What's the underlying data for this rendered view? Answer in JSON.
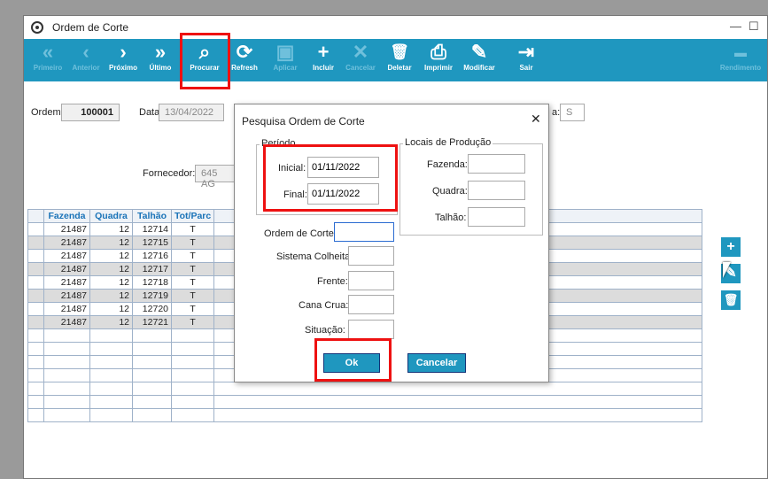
{
  "window": {
    "title": "Ordem de Corte",
    "minimize": "—",
    "maximize": "☐"
  },
  "toolbar": {
    "primeiro": {
      "icon": "«",
      "label": "Primeiro"
    },
    "anterior": {
      "icon": "‹",
      "label": "Anterior"
    },
    "proximo": {
      "icon": "›",
      "label": "Próximo"
    },
    "ultimo": {
      "icon": "»",
      "label": "Último"
    },
    "procurar": {
      "icon": "⌕",
      "label": "Procurar"
    },
    "refresh": {
      "icon": "⟳",
      "label": "Refresh"
    },
    "aplicar": {
      "icon": "▣",
      "label": "Aplicar"
    },
    "incluir": {
      "icon": "+",
      "label": "Incluir"
    },
    "cancelar": {
      "icon": "✕",
      "label": "Cancelar"
    },
    "deletar": {
      "icon": "🗑",
      "label": "Deletar"
    },
    "imprimir": {
      "icon": "⎙",
      "label": "Imprimir"
    },
    "modificar": {
      "icon": "✎",
      "label": "Modificar"
    },
    "sair": {
      "icon": "⇥",
      "label": "Sair"
    },
    "rendimento": {
      "label": "Rendimento"
    }
  },
  "form": {
    "ordem_label": "Ordem:",
    "ordem_value": "100001",
    "data_label": "Data:",
    "data_value": "13/04/2022",
    "s_label": "a:",
    "s_value": "S",
    "fornecedor_label": "Fornecedor:",
    "fornecedor_value": "645 AG"
  },
  "grid": {
    "headers": [
      "Fazenda",
      "Quadra",
      "Talhão",
      "Tot/Parc"
    ],
    "rows": [
      [
        "21487",
        "12",
        "12714",
        "T"
      ],
      [
        "21487",
        "12",
        "12715",
        "T"
      ],
      [
        "21487",
        "12",
        "12716",
        "T"
      ],
      [
        "21487",
        "12",
        "12717",
        "T"
      ],
      [
        "21487",
        "12",
        "12718",
        "T"
      ],
      [
        "21487",
        "12",
        "12719",
        "T"
      ],
      [
        "21487",
        "12",
        "12720",
        "T"
      ],
      [
        "21487",
        "12",
        "12721",
        "T"
      ]
    ]
  },
  "side_buttons": {
    "add": "+",
    "edit": "✎",
    "delete": "🗑"
  },
  "dialog": {
    "title": "Pesquisa Ordem de Corte",
    "close": "✕",
    "periodo_label": "Período",
    "inicial_label": "Inicial:",
    "inicial_value": "01/11/2022",
    "final_label": "Final:",
    "final_value": "01/11/2022",
    "locais_label": "Locais de Produção",
    "fazenda_label": "Fazenda:",
    "quadra_label": "Quadra:",
    "talhao_label": "Talhão:",
    "ordem_label": "Ordem de Corte:",
    "sistema_label": "Sistema Colheita:",
    "frente_label": "Frente:",
    "cana_label": "Cana Crua:",
    "situacao_label": "Situação:",
    "ok_label": "Ok",
    "cancelar_label": "Cancelar"
  }
}
